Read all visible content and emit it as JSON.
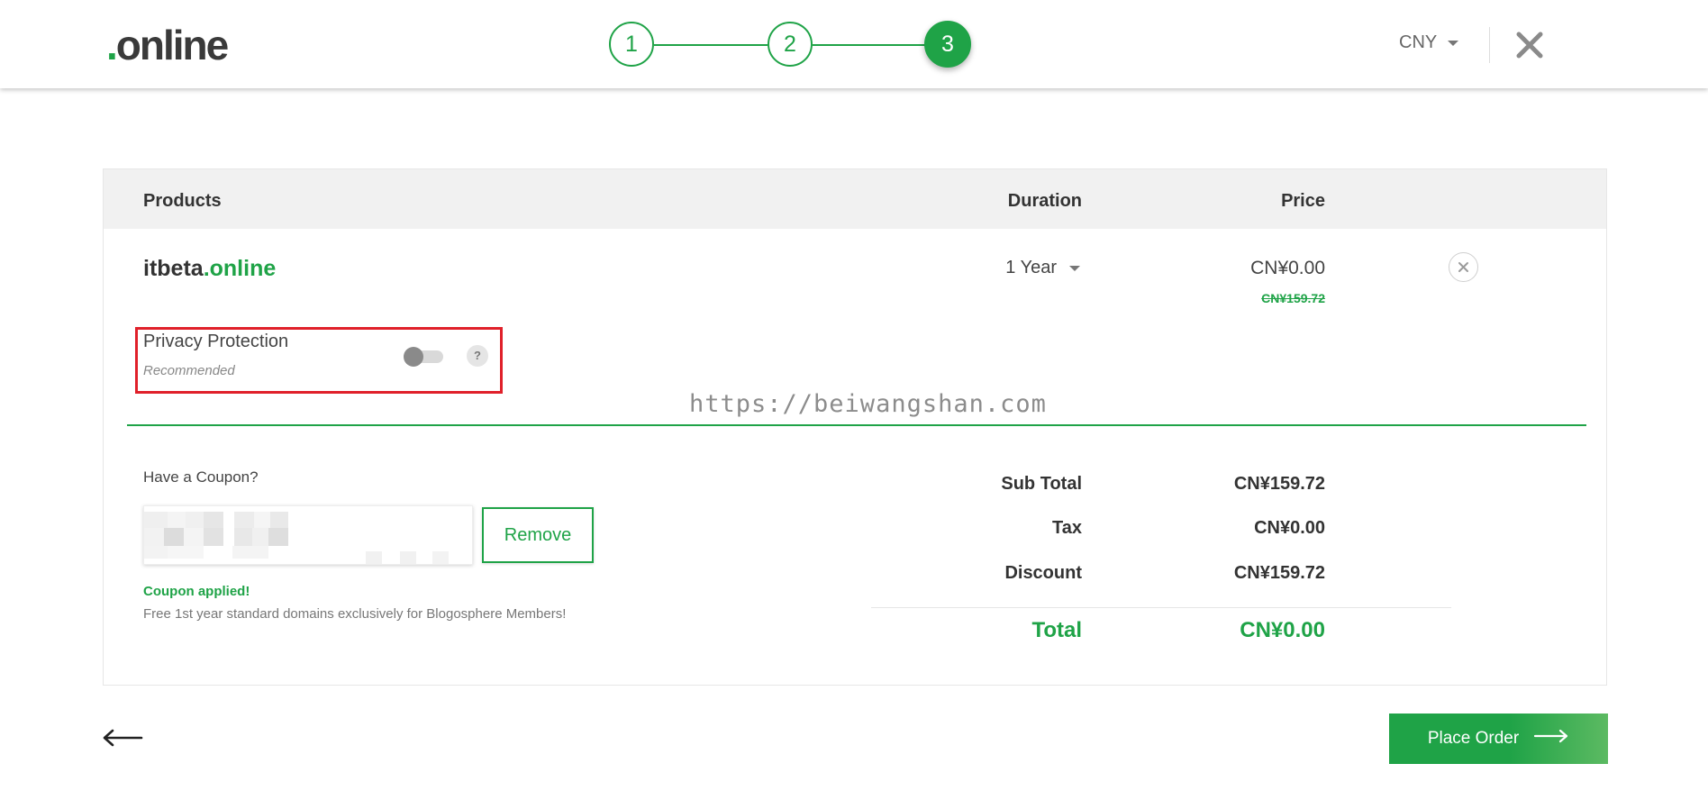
{
  "header": {
    "logo_dot": ".",
    "logo_text": "online",
    "steps": [
      "1",
      "2",
      "3"
    ],
    "currency": "CNY"
  },
  "table": {
    "col_products": "Products",
    "col_duration": "Duration",
    "col_price": "Price"
  },
  "item": {
    "domain_name": "itbeta",
    "domain_tld": ".online",
    "duration": "1 Year",
    "price": "CN¥0.00",
    "original_price": "CN¥159.72"
  },
  "privacy": {
    "title": "Privacy Protection",
    "subtitle": "Recommended",
    "enabled": false,
    "help": "?"
  },
  "watermark": "https://beiwangshan.com",
  "coupon": {
    "label": "Have a Coupon?",
    "remove_label": "Remove",
    "status": "Coupon applied!",
    "note": "Free 1st year standard domains exclusively for Blogosphere Members!"
  },
  "summary": {
    "subtotal_label": "Sub Total",
    "subtotal_value": "CN¥159.72",
    "tax_label": "Tax",
    "tax_value": "CN¥0.00",
    "discount_label": "Discount",
    "discount_value": "CN¥159.72",
    "total_label": "Total",
    "total_value": "CN¥0.00"
  },
  "footer": {
    "place_order_label": "Place Order"
  },
  "colors": {
    "brand_green": "#1fa347",
    "highlight_red": "#e0202a"
  }
}
